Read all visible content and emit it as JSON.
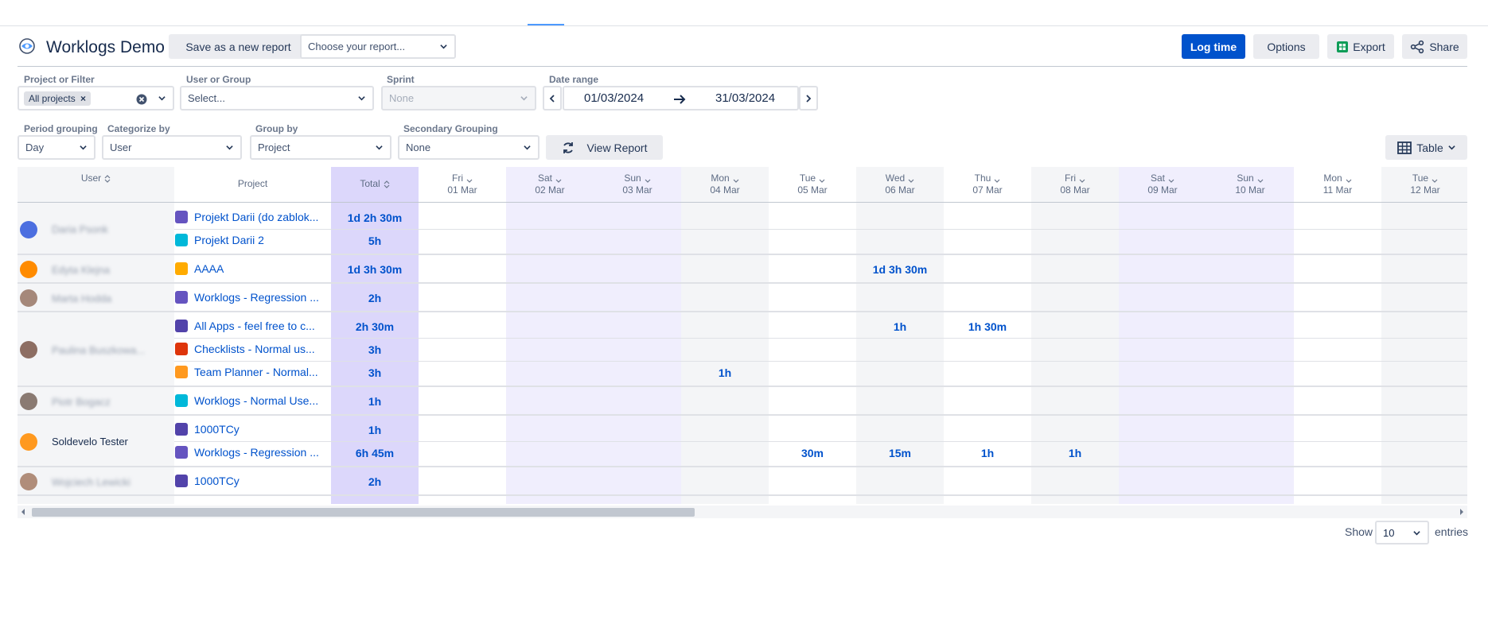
{
  "app": {
    "title": "Worklogs Demo"
  },
  "toolbar": {
    "save_label": "Save as a new report",
    "report_placeholder": "Choose your report...",
    "log_time": "Log time",
    "options": "Options",
    "export": "Export",
    "share": "Share"
  },
  "filters": {
    "project_label": "Project or Filter",
    "project_chip": "All projects",
    "user_label": "User or Group",
    "user_placeholder": "Select...",
    "sprint_label": "Sprint",
    "sprint_value": "None",
    "date_label": "Date range",
    "date_from": "01/03/2024",
    "date_to": "31/03/2024",
    "period_label": "Period grouping",
    "period_value": "Day",
    "categorize_label": "Categorize by",
    "categorize_value": "User",
    "groupby_label": "Group by",
    "groupby_value": "Project",
    "secondary_label": "Secondary Grouping",
    "secondary_value": "None",
    "view_report": "View Report",
    "view_mode": "Table"
  },
  "table": {
    "headers": {
      "user": "User",
      "project": "Project",
      "total": "Total"
    },
    "days": [
      {
        "dow": "Fri",
        "date": "01 Mar",
        "weekend": false
      },
      {
        "dow": "Sat",
        "date": "02 Mar",
        "weekend": true
      },
      {
        "dow": "Sun",
        "date": "03 Mar",
        "weekend": true
      },
      {
        "dow": "Mon",
        "date": "04 Mar",
        "weekend": false
      },
      {
        "dow": "Tue",
        "date": "05 Mar",
        "weekend": false
      },
      {
        "dow": "Wed",
        "date": "06 Mar",
        "weekend": false
      },
      {
        "dow": "Thu",
        "date": "07 Mar",
        "weekend": false
      },
      {
        "dow": "Fri",
        "date": "08 Mar",
        "weekend": false
      },
      {
        "dow": "Sat",
        "date": "09 Mar",
        "weekend": true
      },
      {
        "dow": "Sun",
        "date": "10 Mar",
        "weekend": true
      },
      {
        "dow": "Mon",
        "date": "11 Mar",
        "weekend": false
      },
      {
        "dow": "Tue",
        "date": "12 Mar",
        "weekend": false
      }
    ],
    "groups": [
      {
        "user": "Daria Psonk",
        "avatar_color": "#4c6fe0",
        "blurred": true,
        "rows": [
          {
            "project": "Projekt Darii (do zablok...",
            "icon_color": "#6554c0",
            "total": "1d 2h 30m",
            "cells": {}
          },
          {
            "project": "Projekt Darii 2",
            "icon_color": "#00b8d9",
            "total": "5h",
            "cells": {}
          }
        ]
      },
      {
        "user": "Edyta Klejna",
        "avatar_color": "#ff8b00",
        "blurred": true,
        "rows": [
          {
            "project": "AAAA",
            "icon_color": "#ffab00",
            "total": "1d 3h 30m",
            "cells": {
              "5": "1d 3h 30m"
            }
          }
        ]
      },
      {
        "user": "Marta Hodda",
        "avatar_color": "#a5887a",
        "blurred": true,
        "rows": [
          {
            "project": "Worklogs - Regression ...",
            "icon_color": "#6554c0",
            "total": "2h",
            "cells": {}
          }
        ]
      },
      {
        "user": "Paulina Buszkowa...",
        "avatar_color": "#8d6e63",
        "blurred": true,
        "rows": [
          {
            "project": "All Apps - feel free to c...",
            "icon_color": "#5243aa",
            "total": "2h 30m",
            "cells": {
              "5": "1h",
              "6": "1h 30m"
            }
          },
          {
            "project": "Checklists - Normal us...",
            "icon_color": "#de350b",
            "total": "3h",
            "cells": {}
          },
          {
            "project": "Team Planner - Normal...",
            "icon_color": "#ff991f",
            "total": "3h",
            "cells": {
              "3": "1h"
            }
          }
        ]
      },
      {
        "user": "Piotr Bogacz",
        "avatar_color": "#8a7a72",
        "blurred": true,
        "rows": [
          {
            "project": "Worklogs - Normal Use...",
            "icon_color": "#00b8d9",
            "total": "1h",
            "cells": {}
          }
        ]
      },
      {
        "user": "Soldevelo Tester",
        "avatar_color": "#ff991f",
        "blurred": false,
        "rows": [
          {
            "project": "1000TCy",
            "icon_color": "#5243aa",
            "total": "1h",
            "cells": {}
          },
          {
            "project": "Worklogs - Regression ...",
            "icon_color": "#6554c0",
            "total": "6h 45m",
            "cells": {
              "4": "30m",
              "5": "15m",
              "6": "1h",
              "7": "1h"
            }
          }
        ]
      },
      {
        "user": "Wojciech Lewicki",
        "avatar_color": "#b08d7a",
        "blurred": true,
        "rows": [
          {
            "project": "1000TCy",
            "icon_color": "#5243aa",
            "total": "2h",
            "cells": {}
          }
        ]
      }
    ]
  },
  "footer": {
    "show": "Show",
    "entries_value": "10",
    "entries": "entries"
  }
}
